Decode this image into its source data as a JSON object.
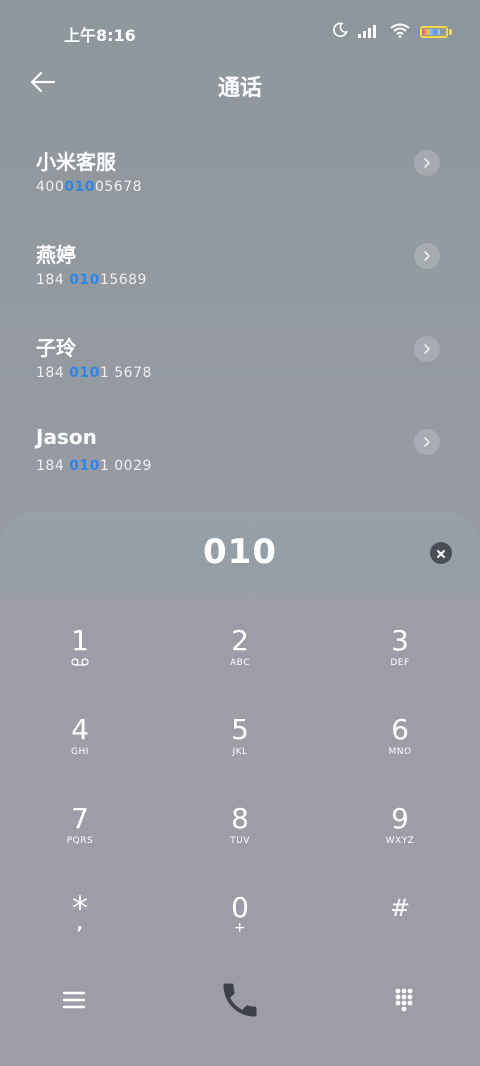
{
  "status_bar": {
    "time": "上午8:16",
    "icons": [
      "moon-icon",
      "signal-icon",
      "wifi-icon",
      "battery-icon"
    ],
    "battery_level": 0.75
  },
  "header": {
    "title": "通话",
    "back_icon": "arrow-left-icon"
  },
  "contacts": [
    {
      "name": "小米客服",
      "number_pre": "400",
      "number_match": "010",
      "number_post": "05678"
    },
    {
      "name": "燕婷",
      "number_pre": "184 ",
      "number_match": "010",
      "number_post": "15689"
    },
    {
      "name": "子玲",
      "number_pre": "184 ",
      "number_match": "010",
      "number_post": "1 5678"
    },
    {
      "name": "Jason",
      "number_pre": "184 ",
      "number_match": "010",
      "number_post": "1 0029"
    }
  ],
  "dialer": {
    "number": "010",
    "keys": [
      {
        "digit": "1",
        "letters": ""
      },
      {
        "digit": "2",
        "letters": "ABC"
      },
      {
        "digit": "3",
        "letters": "DEF"
      },
      {
        "digit": "4",
        "letters": "GHI"
      },
      {
        "digit": "5",
        "letters": "JKL"
      },
      {
        "digit": "6",
        "letters": "MNO"
      },
      {
        "digit": "7",
        "letters": "PQRS"
      },
      {
        "digit": "8",
        "letters": "TUV"
      },
      {
        "digit": "9",
        "letters": "WXYZ"
      },
      {
        "digit": "*",
        "letters": ","
      },
      {
        "digit": "0",
        "letters": "+"
      },
      {
        "digit": "#",
        "letters": ""
      }
    ]
  },
  "colors": {
    "highlight": "#2f86e6",
    "text": "#ffffff",
    "clear_button": "#4a4e55",
    "call_icon": "#3d4149"
  }
}
